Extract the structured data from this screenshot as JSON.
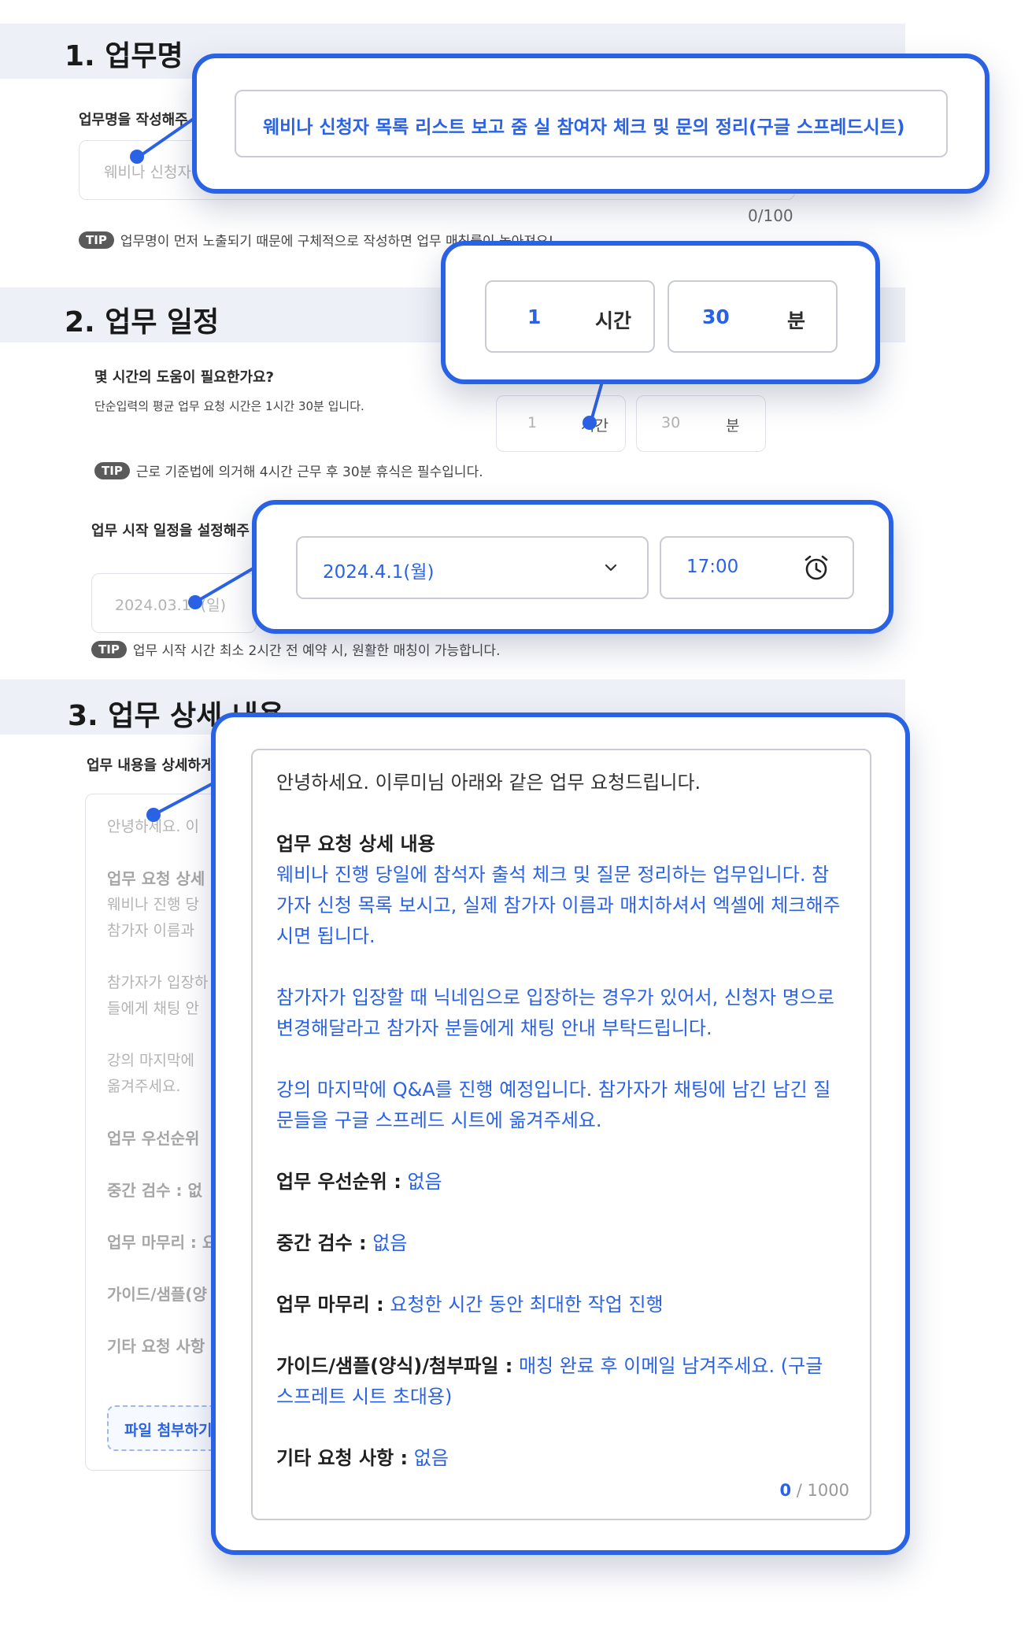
{
  "section1": {
    "title": "1. 업무명",
    "label": "업무명을 작성해주",
    "placeholder": "웨비나 신청자",
    "counter": "0/100",
    "tip_badge": "TIP",
    "tip": "업무명이 먼저 노출되기 때문에 구체적으로 작성하면 업무 매칭률이 높아져요!",
    "callout_value": "웨비나 신청자 목록 리스트 보고 줌 실 참여자 체크 및 문의 정리(구글 스프레드시트)"
  },
  "section2": {
    "title": "2. 업무 일정",
    "hours_question": "몇 시간의 도움이 필요한가요?",
    "hours_sub": "단순입력의 평균 업무 요청 시간은 1시간 30분 입니다.",
    "ghost_hour_value": "1",
    "ghost_hour_unit": "시간",
    "ghost_min_value": "30",
    "ghost_min_unit": "분",
    "tip_badge": "TIP",
    "tip1": "근로 기준법에 의거해 4시간 근무 후 30분 휴식은 필수입니다.",
    "start_question": "업무 시작 일정을 설정해주",
    "ghost_date": "2024.03.1",
    "ghost_date_day": "(일)",
    "tip2": "업무 시작 시간 최소 2시간 전 예약 시, 원활한 매칭이 가능합니다.",
    "callout_hours": {
      "value": "1",
      "unit": "시간"
    },
    "callout_minutes": {
      "value": "30",
      "unit": "분"
    },
    "callout_date": "2024.4.1(월)",
    "callout_time": "17:00"
  },
  "section3": {
    "title": "3. 업무 상세 내용",
    "label": "업무 내용을 상세하게",
    "ghost_lines": [
      "안녕하세요. 이",
      "업무 요청 상세",
      "웨비나 진행 당",
      "참가자 이름과",
      "참가자가 입장하",
      "들에게 채팅 안",
      "강의 마지막에",
      "옮겨주세요.",
      "업무 우선순위",
      "중간 검수 : 없",
      "업무 마무리 : 요",
      "가이드/샘플(양",
      "기타 요청 사항"
    ],
    "attach_button": "파일 첨부하기",
    "detail": {
      "greeting": "안녕하세요. 이루미님 아래와 같은 업무 요청드립니다.",
      "heading": "업무 요청 상세 내용",
      "para1": "웨비나 진행 당일에 참석자 출석 체크 및 질문 정리하는 업무입니다. 참가자 신청 목록 보시고, 실제 참가자 이름과 매치하셔서 엑셀에 체크해주시면 됩니다.",
      "para2": "참가자가 입장할 때 닉네임으로 입장하는 경우가 있어서, 신청자 명으로 변경해달라고 참가자 분들에게 채팅 안내 부탁드립니다.",
      "para3": "강의 마지막에 Q&A를 진행 예정입니다. 참가자가 채팅에 남긴 남긴 질문들을 구글 스프레드 시트에 옮겨주세요.",
      "priority_label": "업무 우선순위 :",
      "priority_value": "없음",
      "review_label": "중간 검수 :",
      "review_value": "없음",
      "finish_label": "업무 마무리 :",
      "finish_value": "요청한 시간 동안 최대한 작업 진행",
      "guide_label": "가이드/샘플(양식)/첨부파일 :",
      "guide_value": "매칭 완료 후 이메일 남겨주세요. (구글 스프레트 시트 초대용)",
      "etc_label": "기타 요청 사항 :",
      "etc_value": "없음",
      "counter_current": "0",
      "counter_total": "/ 1000"
    }
  },
  "colors": {
    "accent": "#2a62e6",
    "band": "#edf0f6",
    "tip_badge": "#5a5a5a"
  },
  "icons": [
    "chevron-down-icon",
    "alarm-clock-icon"
  ]
}
